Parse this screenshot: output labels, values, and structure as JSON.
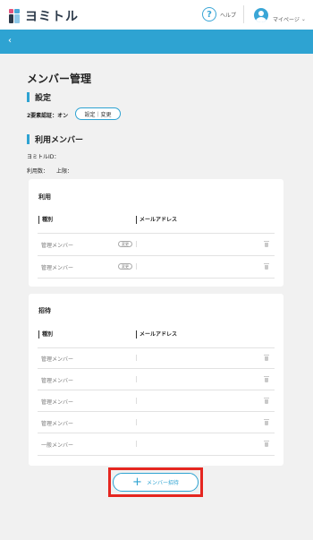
{
  "header": {
    "logo_text": "ヨミトル",
    "help_label": "ヘルプ",
    "mypage_label": "マイページ"
  },
  "page": {
    "title": "メンバー管理",
    "settings_heading": "設定",
    "twofa_label": "2要素認証：オン",
    "twofa_button": "設定｜変更",
    "members_heading": "利用メンバー",
    "yomitoru_id_label": "ヨミトルID：",
    "usage_label": "利用数：",
    "limit_label": "上限："
  },
  "active_card": {
    "title": "利用",
    "col_type": "種別",
    "col_email": "メールアドレス",
    "rows": [
      {
        "type": "管理メンバー",
        "badge": "変更",
        "email": ""
      },
      {
        "type": "管理メンバー",
        "badge": "変更",
        "email": ""
      }
    ]
  },
  "invited_card": {
    "title": "招待",
    "col_type": "種別",
    "col_email": "メールアドレス",
    "rows": [
      {
        "type": "管理メンバー",
        "email": ""
      },
      {
        "type": "管理メンバー",
        "email": ""
      },
      {
        "type": "管理メンバー",
        "email": ""
      },
      {
        "type": "管理メンバー",
        "email": ""
      },
      {
        "type": "一般メンバー",
        "email": ""
      }
    ]
  },
  "invite_button_label": "メンバー招待",
  "colors": {
    "accent": "#2ea3d2",
    "highlight": "#e52620"
  }
}
